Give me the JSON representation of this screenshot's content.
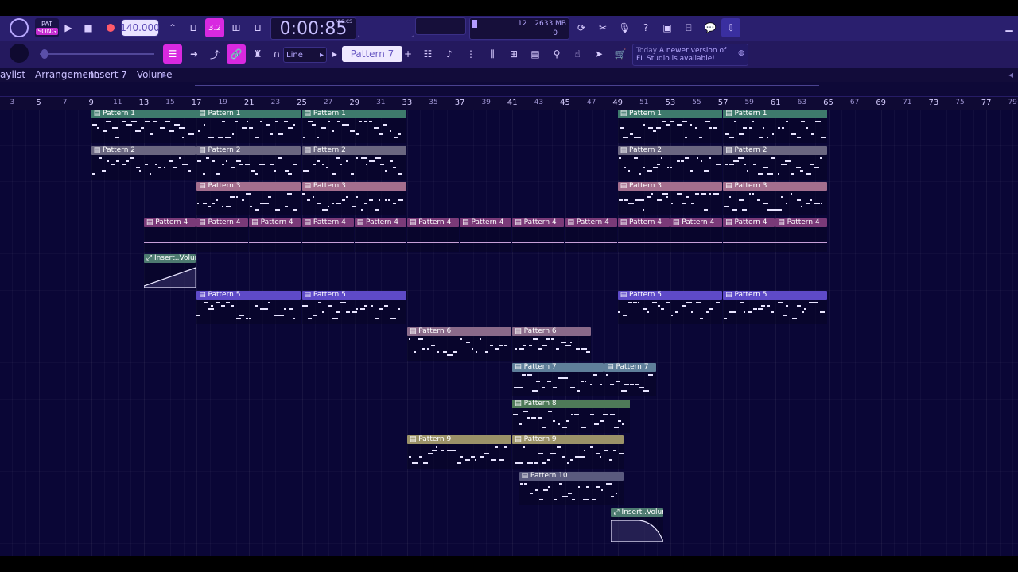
{
  "toolbar": {
    "pat_label": "PAT",
    "song_label": "SONG",
    "tempo": "140.000",
    "time_display": "0:00:85",
    "time_unit": "M:S:CS",
    "cpu_value": "12",
    "ram_value": "2633 MB",
    "voices": "0",
    "snap_mode": "Line",
    "pattern_selector": "Pattern 7",
    "news_today": "Today",
    "news_text": "A newer version of",
    "news_text2": "FL Studio is available!"
  },
  "titlebar": {
    "crumb1": "aylist - Arrangement",
    "crumb2": "Insert 7 - Volume"
  },
  "ruler": {
    "ticks": [
      "3",
      "5",
      "7",
      "9",
      "11",
      "13",
      "15",
      "17",
      "19",
      "21",
      "23",
      "25",
      "27",
      "29",
      "31",
      "33",
      "35",
      "37",
      "39",
      "41",
      "43",
      "45",
      "47",
      "49",
      "51",
      "53",
      "55",
      "57",
      "59",
      "61",
      "63",
      "65",
      "67",
      "69",
      "71",
      "73",
      "75",
      "77",
      "79"
    ]
  },
  "clips": [
    {
      "label": "Pattern 1",
      "track": 0,
      "start": -7,
      "len": 8,
      "color": "#3e7a6c"
    },
    {
      "label": "Pattern 1",
      "track": 0,
      "start": 9,
      "len": 8,
      "color": "#3e7a6c"
    },
    {
      "label": "Pattern 1",
      "track": 0,
      "start": 17,
      "len": 8,
      "color": "#3e7a6c"
    },
    {
      "label": "Pattern 1",
      "track": 0,
      "start": 25,
      "len": 8,
      "color": "#3e7a6c"
    },
    {
      "label": "Pattern 1",
      "track": 0,
      "start": 49,
      "len": 8,
      "color": "#3e7a6c"
    },
    {
      "label": "Pattern 1",
      "track": 0,
      "start": 57,
      "len": 8,
      "color": "#3e7a6c"
    },
    {
      "label": "Pattern 2",
      "track": 1,
      "start": 9,
      "len": 8,
      "color": "#6a6680"
    },
    {
      "label": "Pattern 2",
      "track": 1,
      "start": 17,
      "len": 8,
      "color": "#6a6680"
    },
    {
      "label": "Pattern 2",
      "track": 1,
      "start": 25,
      "len": 8,
      "color": "#6a6680"
    },
    {
      "label": "Pattern 2",
      "track": 1,
      "start": 49,
      "len": 8,
      "color": "#6a6680"
    },
    {
      "label": "Pattern 2",
      "track": 1,
      "start": 57,
      "len": 8,
      "color": "#6a6680"
    },
    {
      "label": "Pattern 3",
      "track": 2,
      "start": 17,
      "len": 8,
      "color": "#a46e8e"
    },
    {
      "label": "Pattern 3",
      "track": 2,
      "start": 25,
      "len": 8,
      "color": "#a46e8e"
    },
    {
      "label": "Pattern 3",
      "track": 2,
      "start": 49,
      "len": 8,
      "color": "#a46e8e"
    },
    {
      "label": "Pattern 3",
      "track": 2,
      "start": 57,
      "len": 8,
      "color": "#a46e8e"
    },
    {
      "label": "Pattern 4",
      "track": 3,
      "start": 13,
      "len": 4,
      "color": "#7a3a78"
    },
    {
      "label": "Pattern 4",
      "track": 3,
      "start": 17,
      "len": 4,
      "color": "#7a3a78"
    },
    {
      "label": "Pattern 4",
      "track": 3,
      "start": 21,
      "len": 4,
      "color": "#7a3a78"
    },
    {
      "label": "Pattern 4",
      "track": 3,
      "start": 25,
      "len": 4,
      "color": "#7a3a78"
    },
    {
      "label": "Pattern 4",
      "track": 3,
      "start": 29,
      "len": 4,
      "color": "#7a3a78"
    },
    {
      "label": "Pattern 4",
      "track": 3,
      "start": 33,
      "len": 4,
      "color": "#7a3a78"
    },
    {
      "label": "Pattern 4",
      "track": 3,
      "start": 37,
      "len": 4,
      "color": "#7a3a78"
    },
    {
      "label": "Pattern 4",
      "track": 3,
      "start": 41,
      "len": 4,
      "color": "#7a3a78"
    },
    {
      "label": "Pattern 4",
      "track": 3,
      "start": 45,
      "len": 4,
      "color": "#7a3a78"
    },
    {
      "label": "Pattern 4",
      "track": 3,
      "start": 49,
      "len": 4,
      "color": "#7a3a78"
    },
    {
      "label": "Pattern 4",
      "track": 3,
      "start": 53,
      "len": 4,
      "color": "#7a3a78"
    },
    {
      "label": "Pattern 4",
      "track": 3,
      "start": 57,
      "len": 4,
      "color": "#7a3a78"
    },
    {
      "label": "Pattern 4",
      "track": 3,
      "start": 61,
      "len": 4,
      "color": "#7a3a78"
    },
    {
      "label": "Insert..Volume",
      "track": 4,
      "start": 13,
      "len": 4,
      "color": "#4d7a70",
      "type": "auto-up"
    },
    {
      "label": "Pattern 5",
      "track": 5,
      "start": 17,
      "len": 8,
      "color": "#5e4ac8"
    },
    {
      "label": "Pattern 5",
      "track": 5,
      "start": 25,
      "len": 8,
      "color": "#5e4ac8"
    },
    {
      "label": "Pattern 5",
      "track": 5,
      "start": 49,
      "len": 8,
      "color": "#5e4ac8"
    },
    {
      "label": "Pattern 5",
      "track": 5,
      "start": 57,
      "len": 8,
      "color": "#5e4ac8"
    },
    {
      "label": "Pattern 6",
      "track": 6,
      "start": 33,
      "len": 8,
      "color": "#8a6a8a"
    },
    {
      "label": "Pattern 6",
      "track": 6,
      "start": 41,
      "len": 6,
      "color": "#8a6a8a"
    },
    {
      "label": "Pattern 7",
      "track": 7,
      "start": 41,
      "len": 7,
      "color": "#5f7f9a"
    },
    {
      "label": "Pattern 7",
      "track": 7,
      "start": 48,
      "len": 4,
      "color": "#5f7f9a"
    },
    {
      "label": "Pattern 8",
      "track": 8,
      "start": 41,
      "len": 9,
      "color": "#4e7a58"
    },
    {
      "label": "Pattern 9",
      "track": 9,
      "start": 33,
      "len": 8,
      "color": "#9b9268"
    },
    {
      "label": "Pattern 9",
      "track": 9,
      "start": 41,
      "len": 8.5,
      "color": "#9b9268"
    },
    {
      "label": "Pattern 10",
      "track": 10,
      "start": 41.5,
      "len": 8,
      "color": "#5a5a7e"
    },
    {
      "label": "Insert..Volume",
      "track": 11,
      "start": 48.5,
      "len": 4,
      "color": "#4d7a70",
      "type": "auto-down"
    }
  ]
}
